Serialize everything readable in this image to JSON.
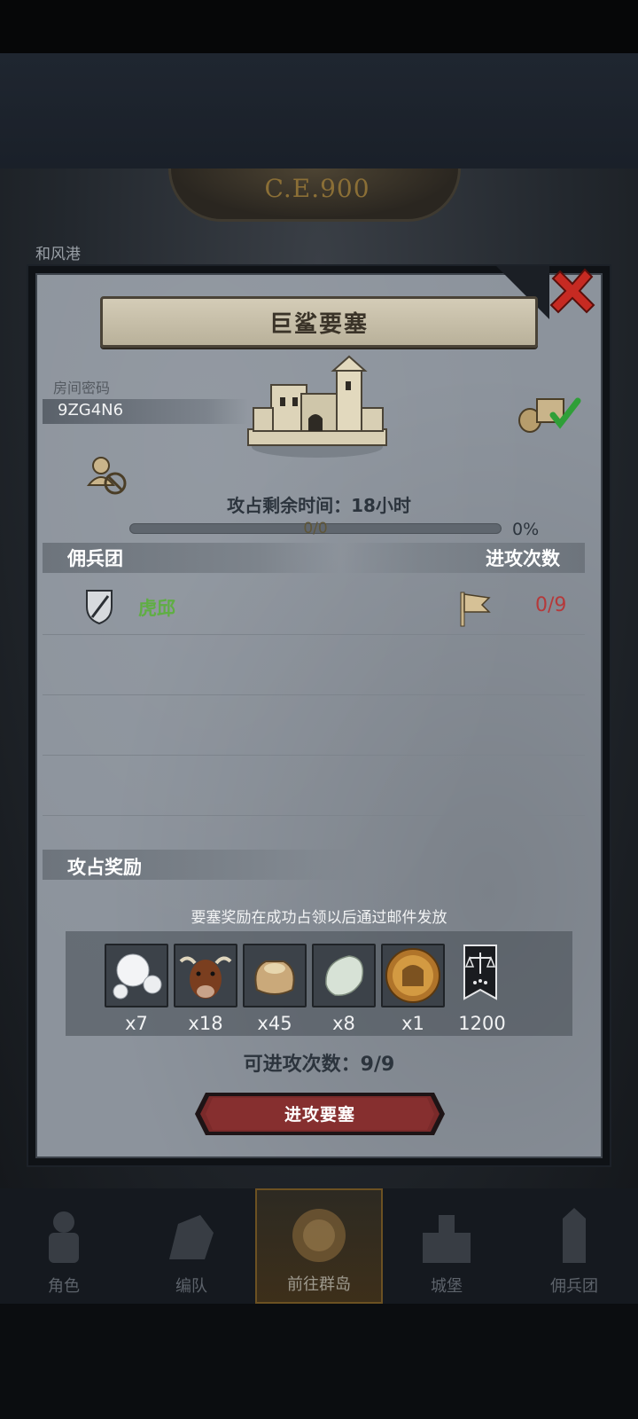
{
  "background": {
    "era": "C.E.900",
    "port_name": "和风港"
  },
  "dialog": {
    "title": "巨鲨要塞",
    "room_code_label": "房间密码",
    "room_code": "9ZG4N6",
    "timer_text": "攻占剩余时间：18小时",
    "progress": {
      "count_text": "0/0",
      "percent_text": "0%",
      "fraction": 0
    },
    "table": {
      "col_mercenary": "佣兵团",
      "col_attacks": "进攻次数",
      "rows": [
        {
          "name": "虎邱",
          "attacks": "0/9"
        }
      ]
    },
    "rewards": {
      "title": "攻占奖励",
      "note": "要塞奖励在成功占领以后通过邮件发放",
      "items": [
        {
          "icon": "pearl-icon",
          "qty": "x7"
        },
        {
          "icon": "ox-icon",
          "qty": "x18"
        },
        {
          "icon": "grain-sack-icon",
          "qty": "x45"
        },
        {
          "icon": "jade-stone-icon",
          "qty": "x8"
        },
        {
          "icon": "knight-helmet-coin-icon",
          "qty": "x1"
        },
        {
          "icon": "justice-banner-icon",
          "qty": "1200"
        }
      ]
    },
    "attack_count_text": "可进攻次数：9/9",
    "attack_button_label": "进攻要塞"
  },
  "bottom_nav": {
    "items": [
      {
        "label": "角色",
        "icon": "knight-icon"
      },
      {
        "label": "编队",
        "icon": "horse-helmet-icon"
      },
      {
        "label": "前往群岛",
        "icon": "compass-icon",
        "active": true
      },
      {
        "label": "城堡",
        "icon": "castle-icon"
      },
      {
        "label": "佣兵团",
        "icon": "tower-icon"
      }
    ]
  },
  "colors": {
    "panel": "#8c939c",
    "title_plate": "#cfc7b1",
    "mercenary_name": "#5fae43",
    "attacks_red": "#b5393a",
    "button_red": "#7a2a2a"
  }
}
